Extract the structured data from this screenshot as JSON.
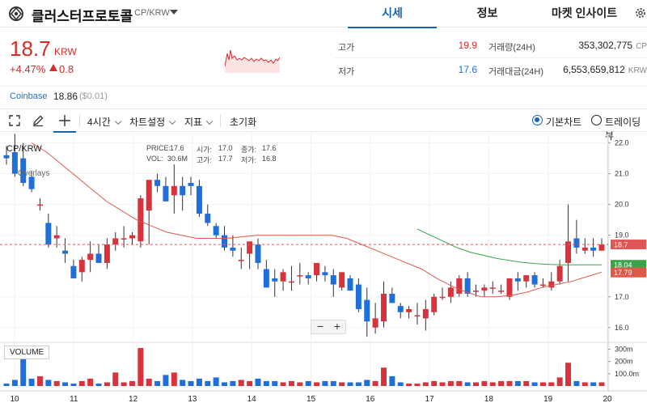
{
  "header": {
    "coin_name": "클러스터프로토콜",
    "pair": "CP/KRW",
    "tabs": [
      {
        "label": "시세",
        "active": true
      },
      {
        "label": "정보",
        "active": false
      },
      {
        "label": "마켓 인사이트",
        "active": false
      }
    ]
  },
  "price": {
    "current": "18.7",
    "unit": "KRW",
    "change_pct": "+4.47%",
    "change_abs": "0.8",
    "color_up": "#d42b2b",
    "color_down": "#1e6fd9"
  },
  "stats": {
    "high_label": "고가",
    "high": "19.9",
    "low_label": "저가",
    "low": "17.6",
    "volume_label": "거래량(24H)",
    "volume": "353,302,775",
    "volume_unit": "CP",
    "value_label": "거래대금(24H)",
    "value": "6,553,659,812",
    "value_unit": "KRW"
  },
  "exchange": {
    "name": "Coinbase",
    "price": "18.86",
    "diff": "($0.01)"
  },
  "toolbar": {
    "interval": "4시간",
    "chart_settings": "차트설정",
    "indicators": "지표",
    "reset": "초기화",
    "basic_chart": "기본차트",
    "tradingview": "트레이딩뷰",
    "selected_chart": "basic"
  },
  "chart": {
    "pair_label": "CP/KRW",
    "overlays_label": "Overlays",
    "ohlc": {
      "price_label": "PRICE:",
      "price": "17.6",
      "open_label": "시가:",
      "open": "17.0",
      "close_label": "종가:",
      "close": "17.6",
      "vol_label": "VOL:",
      "vol": "30.6M",
      "high_label": "고가:",
      "high": "17.7",
      "low_label": "저가:",
      "low": "16.8"
    },
    "volume_label": "VOLUME",
    "zoom_out": "−",
    "zoom_in": "+"
  },
  "chart_data": {
    "type": "candlestick",
    "x_ticks": [
      "10",
      "11",
      "12",
      "13",
      "14",
      "15",
      "16",
      "17",
      "18",
      "19",
      "20"
    ],
    "y_ticks": [
      "22.0",
      "21.0",
      "20.0",
      "19.0",
      "17.0",
      "16.0"
    ],
    "y_range": [
      15.6,
      22.2
    ],
    "volume_ticks": [
      "300m",
      "200m",
      "100.0m"
    ],
    "volume_range": [
      0,
      330
    ],
    "last_price_tag": "18.7",
    "ma_tags": [
      {
        "value": "18.04",
        "color": "#3aa34a"
      },
      {
        "value": "17.79",
        "color": "#e0584a"
      }
    ],
    "up_color": "#d8323c",
    "down_color": "#1e6fd9",
    "candles": [
      [
        21.6,
        21.9,
        21.3,
        21.5
      ],
      [
        21.7,
        22.3,
        20.9,
        21.0
      ],
      [
        21.5,
        22.0,
        20.6,
        20.7
      ],
      [
        20.9,
        21.1,
        20.4,
        20.5
      ],
      [
        20.0,
        20.2,
        19.8,
        20.0
      ],
      [
        19.4,
        19.7,
        18.6,
        18.7
      ],
      [
        18.9,
        19.3,
        18.6,
        19.0
      ],
      [
        18.5,
        18.9,
        18.1,
        18.4
      ],
      [
        18.0,
        18.2,
        17.6,
        17.6
      ],
      [
        17.8,
        18.3,
        17.5,
        18.2
      ],
      [
        18.2,
        18.8,
        17.8,
        18.4
      ],
      [
        18.4,
        18.7,
        18.1,
        18.1
      ],
      [
        18.1,
        18.9,
        17.9,
        18.7
      ],
      [
        18.7,
        19.1,
        18.5,
        18.9
      ],
      [
        18.9,
        19.3,
        18.6,
        18.9
      ],
      [
        18.9,
        19.1,
        18.7,
        19.0
      ],
      [
        18.8,
        20.3,
        18.6,
        20.2
      ],
      [
        19.8,
        20.3,
        18.7,
        20.8
      ],
      [
        20.8,
        21.0,
        20.4,
        20.6
      ],
      [
        20.6,
        20.9,
        20.1,
        20.1
      ],
      [
        20.3,
        21.3,
        19.7,
        20.6
      ],
      [
        20.6,
        20.9,
        19.8,
        20.3
      ],
      [
        20.7,
        20.9,
        20.3,
        20.6
      ],
      [
        20.6,
        20.8,
        19.6,
        19.7
      ],
      [
        19.7,
        20.0,
        19.3,
        19.4
      ],
      [
        19.3,
        19.4,
        18.9,
        19.0
      ],
      [
        19.0,
        19.3,
        18.5,
        18.6
      ],
      [
        18.6,
        19.0,
        18.3,
        18.5
      ],
      [
        18.2,
        18.6,
        17.9,
        18.2
      ],
      [
        18.4,
        18.7,
        17.9,
        18.8
      ],
      [
        18.7,
        18.9,
        17.9,
        18.1
      ],
      [
        17.9,
        18.2,
        17.3,
        17.3
      ],
      [
        17.6,
        17.9,
        17.0,
        17.5
      ],
      [
        17.5,
        17.9,
        17.2,
        17.8
      ],
      [
        17.5,
        18.0,
        17.2,
        17.5
      ],
      [
        17.7,
        18.1,
        17.4,
        17.7
      ],
      [
        17.7,
        17.8,
        17.4,
        17.6
      ],
      [
        17.7,
        18.1,
        17.5,
        18.1
      ],
      [
        17.8,
        18.0,
        17.5,
        17.7
      ],
      [
        17.7,
        17.9,
        17.0,
        17.4
      ],
      [
        17.3,
        17.8,
        17.2,
        17.8
      ],
      [
        17.6,
        17.7,
        17.2,
        17.2
      ],
      [
        17.4,
        17.6,
        16.5,
        16.6
      ],
      [
        16.9,
        17.3,
        15.7,
        16.2
      ],
      [
        16.0,
        16.8,
        15.8,
        16.3
      ],
      [
        16.2,
        17.5,
        16.0,
        17.1
      ],
      [
        17.1,
        17.3,
        16.8,
        16.8
      ],
      [
        16.7,
        16.8,
        16.3,
        16.5
      ],
      [
        16.5,
        16.7,
        16.3,
        16.6
      ],
      [
        16.4,
        16.8,
        16.1,
        16.4
      ],
      [
        16.3,
        16.9,
        15.9,
        16.6
      ],
      [
        16.5,
        17.1,
        16.4,
        17.0
      ],
      [
        17.0,
        17.3,
        16.9,
        17.0
      ],
      [
        17.0,
        17.5,
        16.8,
        17.3
      ],
      [
        17.1,
        17.7,
        17.0,
        17.6
      ],
      [
        17.6,
        17.8,
        17.0,
        17.1
      ],
      [
        17.2,
        17.4,
        17.0,
        17.2
      ],
      [
        17.2,
        17.4,
        17.0,
        17.3
      ],
      [
        17.3,
        17.5,
        17.1,
        17.3
      ],
      [
        17.2,
        17.4,
        17.1,
        17.2
      ],
      [
        17.0,
        17.6,
        16.9,
        17.6
      ],
      [
        17.6,
        17.8,
        17.2,
        17.5
      ],
      [
        17.5,
        17.7,
        17.3,
        17.7
      ],
      [
        17.7,
        17.8,
        17.3,
        17.4
      ],
      [
        17.4,
        17.6,
        17.3,
        17.4
      ],
      [
        17.3,
        17.8,
        17.2,
        17.5
      ],
      [
        17.5,
        18.2,
        17.4,
        18.0
      ],
      [
        18.1,
        20.0,
        17.5,
        18.8
      ],
      [
        18.9,
        19.5,
        18.4,
        18.6
      ],
      [
        18.5,
        18.9,
        18.4,
        18.6
      ],
      [
        18.6,
        18.9,
        18.3,
        18.5
      ],
      [
        18.5,
        18.9,
        18.5,
        18.7
      ]
    ],
    "volumes": [
      20,
      50,
      260,
      60,
      80,
      50,
      40,
      30,
      20,
      40,
      60,
      20,
      30,
      110,
      30,
      40,
      310,
      60,
      40,
      90,
      110,
      50,
      40,
      60,
      40,
      70,
      30,
      40,
      50,
      40,
      60,
      40,
      40,
      30,
      40,
      30,
      40,
      30,
      40,
      40,
      30,
      30,
      30,
      50,
      40,
      150,
      80,
      30,
      20,
      20,
      30,
      40,
      30,
      40,
      40,
      30,
      30,
      40,
      30,
      40,
      40,
      40,
      40,
      30,
      30,
      30,
      70,
      190,
      40,
      30,
      30,
      30
    ],
    "ma_short": [
      22.0,
      21.7,
      21.3,
      20.9,
      20.5,
      20.1,
      19.8,
      19.5,
      19.3,
      19.1,
      19.0,
      18.9,
      18.9,
      18.9,
      18.95,
      19.0,
      19.0,
      19.0,
      19.0,
      19.0,
      19.0,
      18.9,
      18.7,
      18.5,
      18.3,
      18.1,
      17.9,
      17.6,
      17.35,
      17.15,
      17.0,
      17.0,
      17.05,
      17.15,
      17.3,
      17.4,
      17.5,
      17.65,
      17.8
    ],
    "ma_long": [
      19.2,
      19.0,
      18.8,
      18.6,
      18.45,
      18.35,
      18.25,
      18.18,
      18.12,
      18.08,
      18.05,
      18.04,
      18.04,
      18.04,
      18.04
    ]
  }
}
